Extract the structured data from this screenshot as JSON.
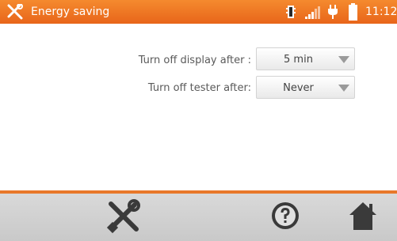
{
  "header": {
    "title": "Energy saving",
    "time": "11:12",
    "app_icon": "tools-icon",
    "status_icons": [
      "memory-chip-icon",
      "signal-bars-icon",
      "power-plug-icon",
      "battery-icon"
    ]
  },
  "settings": {
    "rows": [
      {
        "label": "Turn off display after :",
        "value": "5 min"
      },
      {
        "label": "Turn off tester after:",
        "value": "Never"
      }
    ]
  },
  "footer": {
    "buttons": [
      "tools-icon",
      "help-icon",
      "home-icon"
    ]
  },
  "colors": {
    "accent": "#e8782a",
    "header_top": "#f58a2e",
    "footer_bg": "#d0d0d0",
    "icon_dark": "#3a3a3a"
  }
}
